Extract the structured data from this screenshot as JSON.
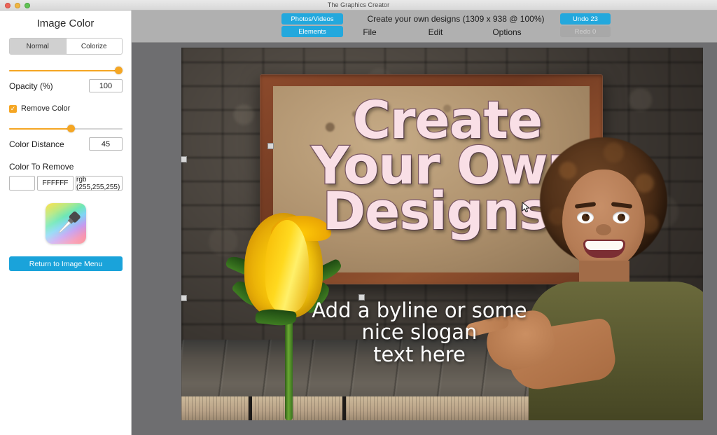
{
  "window": {
    "title": "The Graphics Creator",
    "traffic_lights": [
      "close",
      "minimize",
      "zoom"
    ]
  },
  "sidebar": {
    "panel_title": "Image Color",
    "mode_segments": [
      {
        "label": "Normal",
        "selected": true
      },
      {
        "label": "Colorize",
        "selected": false
      }
    ],
    "opacity": {
      "label": "Opacity (%)",
      "value": "100",
      "slider_percent": 100
    },
    "remove_color": {
      "label": "Remove Color",
      "checked": true
    },
    "color_distance": {
      "label": "Color Distance",
      "value": "45",
      "slider_percent": 55
    },
    "color_to_remove": {
      "label": "Color To Remove",
      "swatch_hex": "#FFFFFF",
      "hex_value": "FFFFFF",
      "rgb_value": "rgb (255,255,255)"
    },
    "eyedropper_icon": "eyedropper-icon",
    "return_button": "Return to Image Menu"
  },
  "toolbar": {
    "photos_videos": "Photos/Videos",
    "elements": "Elements",
    "doc_info": "Create your own designs (1309 x 938 @ 100%)",
    "menus": [
      {
        "label": "File"
      },
      {
        "label": "Edit"
      },
      {
        "label": "Options"
      }
    ],
    "undo": {
      "label": "Undo 23",
      "enabled": true
    },
    "redo": {
      "label": "Redo 0",
      "enabled": false
    },
    "accent_blue": "#23a8dd",
    "background": "#b0b0b0"
  },
  "canvas": {
    "headline_lines": [
      "Create",
      "Your Own",
      "Designs!"
    ],
    "headline_color": "#f9dfe6",
    "headline_outline": "#7d5a66",
    "byline_lines": [
      "Add a byline or some",
      "nice slogan",
      "text here"
    ],
    "byline_color": "#ffffff",
    "background_description": "stone-wall",
    "selection_handles": 6
  }
}
